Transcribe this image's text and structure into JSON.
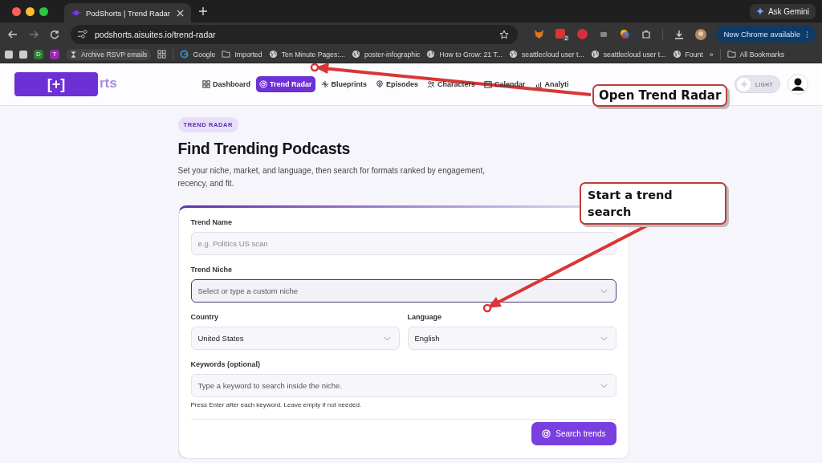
{
  "browser": {
    "tabs": [
      {
        "title": "PodShorts | Trend Radar",
        "selected": true
      }
    ],
    "gemini": "Ask Gemini",
    "address": "podshorts.aisuites.io/trend-radar",
    "extension_badge": "2",
    "update_button": "New Chrome available",
    "bookmarks": [
      {
        "kind": "square"
      },
      {
        "kind": "square"
      },
      {
        "kind": "letter",
        "label": "D",
        "color": "#2e7d32"
      },
      {
        "kind": "letter",
        "label": "T",
        "color": "#9c27b0"
      },
      {
        "kind": "hourglass",
        "label": "Archive RSVP emails"
      },
      {
        "kind": "apps"
      },
      {
        "kind": "google",
        "label": "Google"
      },
      {
        "kind": "folder",
        "label": "Imported"
      },
      {
        "kind": "globe",
        "label": "Ten Minute Pages:..."
      },
      {
        "kind": "globe",
        "label": "poster-infographic"
      },
      {
        "kind": "globe",
        "label": "How to Grow: 21 T..."
      },
      {
        "kind": "globe",
        "label": "seattlecloud user t..."
      },
      {
        "kind": "globe",
        "label": "seattlecloud user t..."
      },
      {
        "kind": "globe",
        "label": "Fount"
      }
    ],
    "more": "»",
    "all_bookmarks": "All Bookmarks"
  },
  "app": {
    "logo_cover": "[+]",
    "logo_text": "rts",
    "nav": [
      {
        "label": "Dashboard",
        "selected": false
      },
      {
        "label": "Trend Radar",
        "selected": true
      },
      {
        "label": "Blueprints",
        "selected": false
      },
      {
        "label": "Episodes",
        "selected": false
      },
      {
        "label": "Characters",
        "selected": false
      },
      {
        "label": "Calendar",
        "selected": false
      },
      {
        "label": "Analyti",
        "selected": false
      }
    ],
    "theme_toggle": {
      "label": "LIGHT",
      "on": false
    }
  },
  "page": {
    "badge": "TREND RADAR",
    "title": "Find Trending Podcasts",
    "description": "Set your niche, market, and language, then search for formats ranked by engagement, recency, and fit.",
    "fields": [
      {
        "label": "Trend Name",
        "kind": "text",
        "placeholder": "e.g. Politics US scan",
        "focused": false
      },
      {
        "label": "Trend Niche",
        "kind": "select",
        "placeholder": "Select or type a custom niche",
        "focused": true
      },
      {
        "label": "Country",
        "kind": "select",
        "value": "United States",
        "focused": false
      },
      {
        "label": "Language",
        "kind": "select",
        "value": "English",
        "focused": false
      },
      {
        "label": "Keywords (optional)",
        "kind": "select",
        "placeholder": "Type a keyword to search inside the niche.",
        "focused": false
      }
    ],
    "hint": "Press Enter after each keyword. Leave empty if not needed.",
    "submit": "Search trends"
  },
  "callouts": [
    {
      "text": "Open Trend Radar"
    },
    {
      "text": "Start a trend search"
    }
  ]
}
